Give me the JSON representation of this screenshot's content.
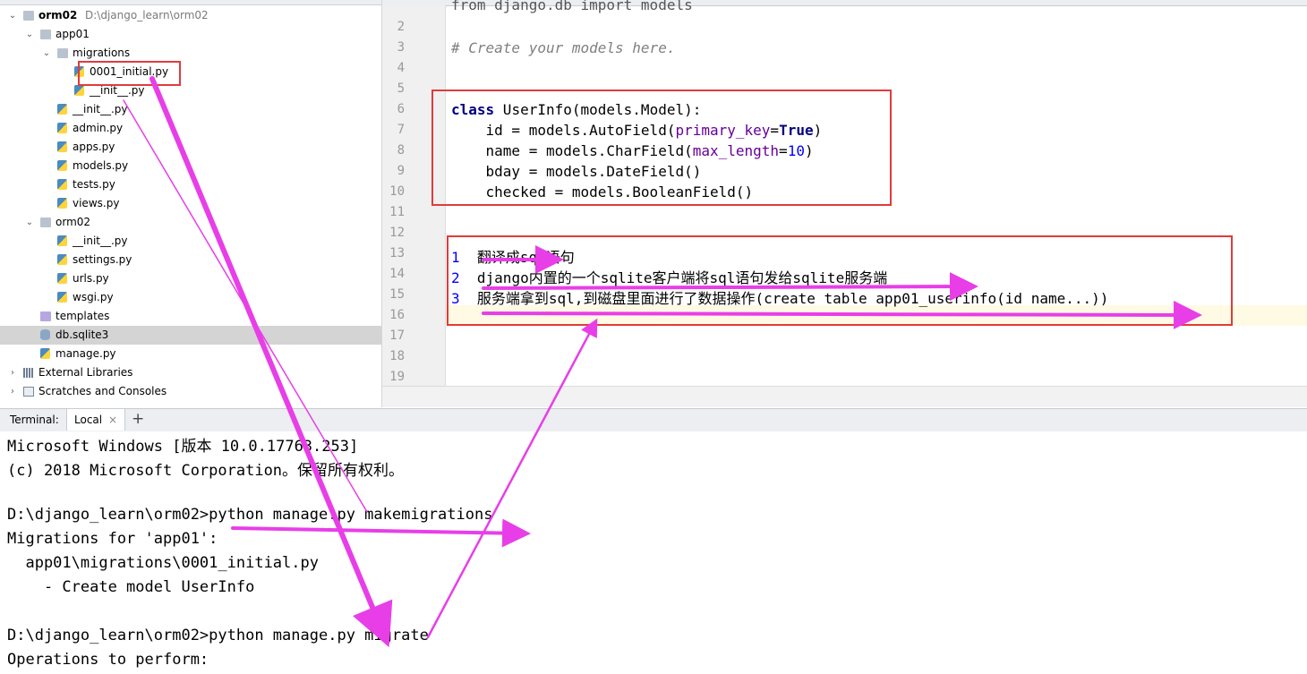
{
  "project_tree": {
    "items": [
      {
        "label": "orm02",
        "path": "D:\\django_learn\\orm02",
        "icon": "folder-icon",
        "arrow": "expanded",
        "indent": 0,
        "bold": true
      },
      {
        "label": "app01",
        "icon": "folder-icon",
        "arrow": "expanded",
        "indent": 1
      },
      {
        "label": "migrations",
        "icon": "folder-icon",
        "arrow": "expanded",
        "indent": 2
      },
      {
        "label": "0001_initial.py",
        "icon": "python-file-icon",
        "indent": 3
      },
      {
        "label": "__init__.py",
        "icon": "python-file-icon",
        "indent": 3
      },
      {
        "label": "__init__.py",
        "icon": "python-file-icon",
        "indent": 2
      },
      {
        "label": "admin.py",
        "icon": "python-file-icon",
        "indent": 2
      },
      {
        "label": "apps.py",
        "icon": "python-file-icon",
        "indent": 2
      },
      {
        "label": "models.py",
        "icon": "python-file-icon",
        "indent": 2
      },
      {
        "label": "tests.py",
        "icon": "python-file-icon",
        "indent": 2
      },
      {
        "label": "views.py",
        "icon": "python-file-icon",
        "indent": 2
      },
      {
        "label": "orm02",
        "icon": "folder-icon",
        "arrow": "expanded",
        "indent": 1
      },
      {
        "label": "__init__.py",
        "icon": "python-file-icon",
        "indent": 2
      },
      {
        "label": "settings.py",
        "icon": "python-file-icon",
        "indent": 2
      },
      {
        "label": "urls.py",
        "icon": "python-file-icon",
        "indent": 2
      },
      {
        "label": "wsgi.py",
        "icon": "python-file-icon",
        "indent": 2
      },
      {
        "label": "templates",
        "icon": "templates-folder-icon",
        "indent": 1
      },
      {
        "label": "db.sqlite3",
        "icon": "database-icon",
        "indent": 1,
        "selected": true
      },
      {
        "label": "manage.py",
        "icon": "python-file-icon",
        "indent": 1
      },
      {
        "label": "External Libraries",
        "icon": "library-icon",
        "arrow": "collapsed",
        "indent": 0
      },
      {
        "label": "Scratches and Consoles",
        "icon": "scratches-icon",
        "arrow": "collapsed",
        "indent": 0
      }
    ]
  },
  "editor": {
    "line_numbers": [
      "2",
      "3",
      "4",
      "5",
      "6",
      "7",
      "8",
      "9",
      "10",
      "11",
      "12",
      "13",
      "14",
      "15",
      "16",
      "17",
      "18",
      "19"
    ],
    "partial_first_line": "from django.db import models",
    "comment": "# Create your models here.",
    "class_line": {
      "kw": "class",
      "rest": " UserInfo(models.Model):"
    },
    "field_id": {
      "a": "    id = models.AutoField(",
      "param": "primary_key",
      "eq": "=",
      "val": "True",
      "end": ")"
    },
    "field_name": {
      "a": "    name = models.CharField(",
      "param": "max_length",
      "eq": "=",
      "val": "10",
      "end": ")"
    },
    "field_bday": "    bday = models.DateField()",
    "field_checked": "    checked = models.BooleanField()",
    "notes": [
      {
        "num": "1",
        "text": "  翻译成sql语句"
      },
      {
        "num": "2",
        "text": "  django内置的一个sqlite客户端将sql语句发给sqlite服务端"
      },
      {
        "num": "3",
        "text": "  服务端拿到sql,到磁盘里面进行了数据操作(create table app01_userinfo(id name...))"
      }
    ]
  },
  "terminal": {
    "title": "Terminal:",
    "tab_label": "Local",
    "close_glyph": "×",
    "add_glyph": "+",
    "lines": [
      "Microsoft Windows [版本 10.0.17763.253]",
      "(c) 2018 Microsoft Corporation。保留所有权利。",
      "",
      "D:\\django_learn\\orm02>python manage.py makemigrations",
      "Migrations for 'app01':",
      "  app01\\migrations\\0001_initial.py",
      "    - Create model UserInfo",
      "",
      "D:\\django_learn\\orm02>python manage.py migrate",
      "Operations to perform:"
    ]
  },
  "colors": {
    "annotation_red": "#e03b3b",
    "annotation_magenta": "#e83ee8"
  }
}
